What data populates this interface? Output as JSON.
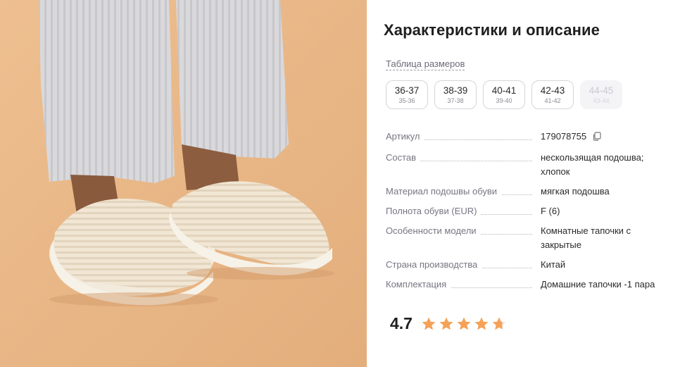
{
  "header": {
    "title": "Характеристики и описание"
  },
  "size_table_link": "Таблица размеров",
  "sizes": [
    {
      "label": "36-37",
      "sub": "35-36",
      "available": true
    },
    {
      "label": "38-39",
      "sub": "37-38",
      "available": true
    },
    {
      "label": "40-41",
      "sub": "39-40",
      "available": true
    },
    {
      "label": "42-43",
      "sub": "41-42",
      "available": true
    },
    {
      "label": "44-45",
      "sub": "43-44",
      "available": false
    }
  ],
  "specs": [
    {
      "label": "Артикул",
      "value": "179078755"
    },
    {
      "label": "Состав",
      "value": "нескользящая подошва; хлопок"
    },
    {
      "label": "Материал подошвы обуви",
      "value": "мягкая подошва"
    },
    {
      "label": "Полнота обуви (EUR)",
      "value": "F (6)"
    },
    {
      "label": "Особенности модели",
      "value": "Комнатные тапочки с закрытые"
    },
    {
      "label": "Страна производства",
      "value": "Китай"
    },
    {
      "label": "Комплектация",
      "value": "Домашние тапочки -1 пара"
    }
  ],
  "rating": {
    "score": "4.7",
    "stars_filled": 4.7,
    "stars_total": 5
  },
  "colors": {
    "star": "#f5a257",
    "star_empty": "#e6e6ea",
    "background_photo": "#e9b98a"
  },
  "icons": {
    "copy": "copy-icon",
    "star": "star-icon"
  }
}
